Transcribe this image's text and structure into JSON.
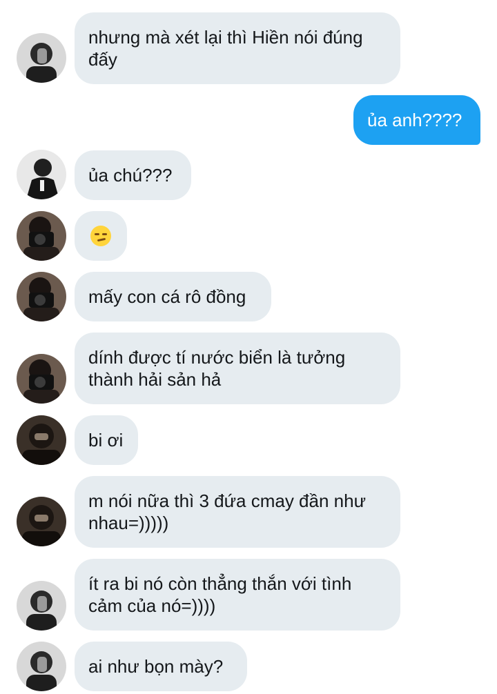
{
  "messages": [
    {
      "text": "nhưng mà xét lại thì Hiền nói đúng đấy",
      "avatar_icon": "profile-photo-hand-face-icon"
    },
    {
      "text": "ủa anh????"
    },
    {
      "text": "ủa chú???",
      "avatar_icon": "profile-photo-suit-man-icon"
    },
    {
      "text": "",
      "emoji": "smirking-face",
      "avatar_icon": "profile-photo-camera-icon"
    },
    {
      "text": "mấy con cá rô đồng",
      "avatar_icon": "profile-photo-camera-icon"
    },
    {
      "text": "dính được tí nước biển là tưởng thành hải sản hả",
      "avatar_icon": "profile-photo-camera-icon"
    },
    {
      "text": "bi ơi",
      "avatar_icon": "profile-photo-dark-face-icon"
    },
    {
      "text": "m nói nữa thì 3 đứa cmay đần như nhau=)))))",
      "avatar_icon": "profile-photo-dark-face-icon"
    },
    {
      "text": "ít ra bi nó còn thẳng thắn với tình cảm của nó=))))",
      "avatar_icon": "profile-photo-hand-face-icon"
    },
    {
      "text": "ai như bọn mày?",
      "avatar_icon": "profile-photo-hand-face-icon"
    }
  ],
  "colors": {
    "incoming_bubble": "#e6ecf0",
    "outgoing_bubble": "#1da1f2",
    "incoming_text": "#14171a",
    "outgoing_text": "#ffffff"
  }
}
